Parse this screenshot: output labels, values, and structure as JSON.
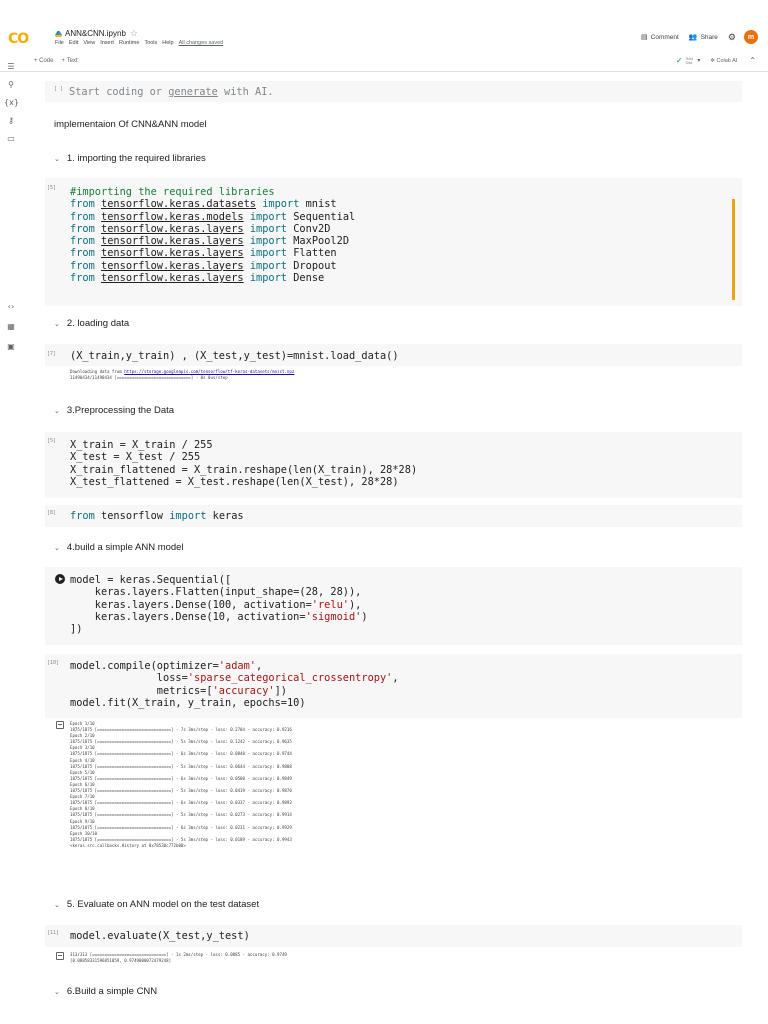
{
  "app": {
    "logo": "CO",
    "file_name": "ANN&CNN.ipynb",
    "menu": [
      "File",
      "Edit",
      "View",
      "Insert",
      "Runtime",
      "Tools",
      "Help"
    ],
    "save_status": "All changes saved",
    "comment_label": "Comment",
    "share_label": "Share",
    "avatar_letter": "m",
    "toolbar_code": "+ Code",
    "toolbar_text": "+ Text",
    "ram_label": "RAM",
    "disk_label": "Disk",
    "colab_ai_label": "Colab AI"
  },
  "cells": {
    "hint_prompt": "[ ]",
    "hint_pre": "Start coding or ",
    "hint_link": "generate",
    "hint_post": " with AI.",
    "md_title": "implementaion Of CNN&ANN model",
    "h1": "1. importing the required libraries",
    "c1_prompt": "[5]",
    "c1_comment": "#importing the required libraries",
    "imports": [
      {
        "module": "tensorflow.keras.datasets",
        "name": "mnist"
      },
      {
        "module": "tensorflow.keras.models",
        "name": "Sequential"
      },
      {
        "module": "tensorflow.keras.layers",
        "name": "Conv2D"
      },
      {
        "module": "tensorflow.keras.layers",
        "name": "MaxPool2D"
      },
      {
        "module": "tensorflow.keras.layers",
        "name": "Flatten"
      },
      {
        "module": "tensorflow.keras.layers",
        "name": "Dropout"
      },
      {
        "module": "tensorflow.keras.layers",
        "name": "Dense"
      }
    ],
    "h2": "2. loading data",
    "c2_prompt": "[7]",
    "c2_code": "(X_train,y_train) , (X_test,y_test)=mnist.load_data()",
    "c2_out_pre": "Downloading data from ",
    "c2_out_url": "https://storage.googleapis.com/tensorflow/tf-keras-datasets/mnist.npz",
    "c2_out_progress": "11490434/11490434 [==============================] - 0s 0us/step",
    "h3": "3.Preprocessing the Data",
    "c3_prompt": "[5]",
    "c3_lines": [
      "X_train = X_train / 255",
      "X_test = X_test / 255",
      "X_train_flattened = X_train.reshape(len(X_train), 28*28)",
      "X_test_flattened = X_test.reshape(len(X_test), 28*28)"
    ],
    "c4_prompt": "[8]",
    "c4_module": "tensorflow",
    "c4_name": "keras",
    "h4": "4.build a simple ANN model",
    "c5_line1": "model = keras.Sequential([",
    "c5_line2": "    keras.layers.Flatten(input_shape=(28, 28)),",
    "c5_line3_pre": "    keras.layers.Dense(100, activation=",
    "c5_line3_str": "'relu'",
    "c5_line3_post": "),",
    "c5_line4_pre": "    keras.layers.Dense(10, activation=",
    "c5_line4_str": "'sigmoid'",
    "c5_line4_post": ")",
    "c5_line5": "])",
    "c6_prompt": "[10]",
    "c6_l1_pre": "model.compile(optimizer=",
    "c6_l1_str": "'adam'",
    "c6_l1_post": ",",
    "c6_l2_pre": "              loss=",
    "c6_l2_str": "'sparse_categorical_crossentropy'",
    "c6_l2_post": ",",
    "c6_l3_pre": "              metrics=[",
    "c6_l3_str": "'accuracy'",
    "c6_l3_post": "])",
    "c6_l4": "model.fit(X_train, y_train, epochs=10)",
    "c6_output": [
      "Epoch 1/10",
      "1875/1875 [==============================] - 7s 3ms/step - loss: 0.2704 - accuracy: 0.9216",
      "Epoch 2/10",
      "1875/1875 [==============================] - 5s 3ms/step - loss: 0.1242 - accuracy: 0.9635",
      "Epoch 3/10",
      "1875/1875 [==============================] - 6s 3ms/step - loss: 0.0848 - accuracy: 0.9744",
      "Epoch 4/10",
      "1875/1875 [==============================] - 5s 3ms/step - loss: 0.0644 - accuracy: 0.9808",
      "Epoch 5/10",
      "1875/1875 [==============================] - 6s 3ms/step - loss: 0.0500 - accuracy: 0.9849",
      "Epoch 6/10",
      "1875/1875 [==============================] - 5s 3ms/step - loss: 0.0419 - accuracy: 0.9870",
      "Epoch 7/10",
      "1875/1875 [==============================] - 6s 3ms/step - loss: 0.0337 - accuracy: 0.9892",
      "Epoch 8/10",
      "1875/1875 [==============================] - 5s 3ms/step - loss: 0.0273 - accuracy: 0.9914",
      "Epoch 9/10",
      "1875/1875 [==============================] - 6s 3ms/step - loss: 0.0231 - accuracy: 0.9929",
      "Epoch 10/10",
      "1875/1875 [==============================] - 5s 3ms/step - loss: 0.0189 - accuracy: 0.9943",
      "<keras.src.callbacks.History at 0x78530c772b00>"
    ],
    "h5": "5. Evaluate on ANN model on the test dataset",
    "c7_prompt": "[11]",
    "c7_code": "model.evaluate(X_test,y_test)",
    "c7_output": [
      "313/313 [==============================] - 1s 2ms/step - loss: 0.0885 - accuracy: 0.9749",
      "[0.08858331596851059, 0.9749000072479248]"
    ],
    "h6": "6.Build a simple CNN"
  }
}
